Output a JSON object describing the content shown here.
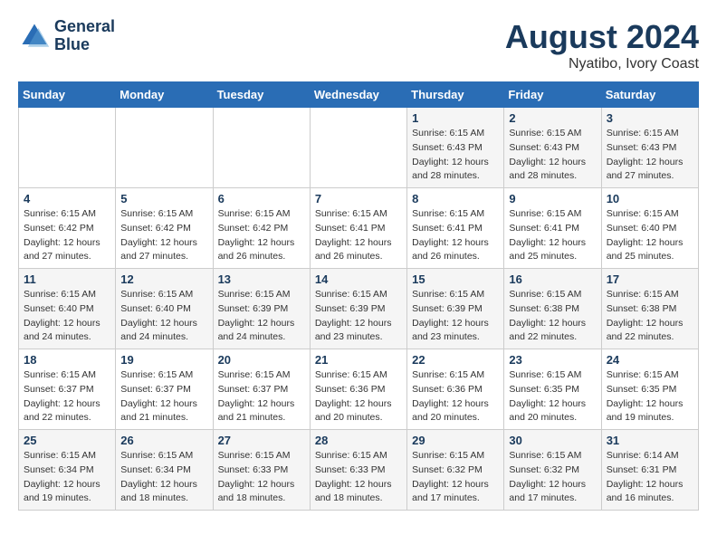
{
  "header": {
    "logo_line1": "General",
    "logo_line2": "Blue",
    "main_title": "August 2024",
    "subtitle": "Nyatibo, Ivory Coast"
  },
  "weekdays": [
    "Sunday",
    "Monday",
    "Tuesday",
    "Wednesday",
    "Thursday",
    "Friday",
    "Saturday"
  ],
  "weeks": [
    [
      {
        "day": "",
        "info": ""
      },
      {
        "day": "",
        "info": ""
      },
      {
        "day": "",
        "info": ""
      },
      {
        "day": "",
        "info": ""
      },
      {
        "day": "1",
        "info": "Sunrise: 6:15 AM\nSunset: 6:43 PM\nDaylight: 12 hours\nand 28 minutes."
      },
      {
        "day": "2",
        "info": "Sunrise: 6:15 AM\nSunset: 6:43 PM\nDaylight: 12 hours\nand 28 minutes."
      },
      {
        "day": "3",
        "info": "Sunrise: 6:15 AM\nSunset: 6:43 PM\nDaylight: 12 hours\nand 27 minutes."
      }
    ],
    [
      {
        "day": "4",
        "info": "Sunrise: 6:15 AM\nSunset: 6:42 PM\nDaylight: 12 hours\nand 27 minutes."
      },
      {
        "day": "5",
        "info": "Sunrise: 6:15 AM\nSunset: 6:42 PM\nDaylight: 12 hours\nand 27 minutes."
      },
      {
        "day": "6",
        "info": "Sunrise: 6:15 AM\nSunset: 6:42 PM\nDaylight: 12 hours\nand 26 minutes."
      },
      {
        "day": "7",
        "info": "Sunrise: 6:15 AM\nSunset: 6:41 PM\nDaylight: 12 hours\nand 26 minutes."
      },
      {
        "day": "8",
        "info": "Sunrise: 6:15 AM\nSunset: 6:41 PM\nDaylight: 12 hours\nand 26 minutes."
      },
      {
        "day": "9",
        "info": "Sunrise: 6:15 AM\nSunset: 6:41 PM\nDaylight: 12 hours\nand 25 minutes."
      },
      {
        "day": "10",
        "info": "Sunrise: 6:15 AM\nSunset: 6:40 PM\nDaylight: 12 hours\nand 25 minutes."
      }
    ],
    [
      {
        "day": "11",
        "info": "Sunrise: 6:15 AM\nSunset: 6:40 PM\nDaylight: 12 hours\nand 24 minutes."
      },
      {
        "day": "12",
        "info": "Sunrise: 6:15 AM\nSunset: 6:40 PM\nDaylight: 12 hours\nand 24 minutes."
      },
      {
        "day": "13",
        "info": "Sunrise: 6:15 AM\nSunset: 6:39 PM\nDaylight: 12 hours\nand 24 minutes."
      },
      {
        "day": "14",
        "info": "Sunrise: 6:15 AM\nSunset: 6:39 PM\nDaylight: 12 hours\nand 23 minutes."
      },
      {
        "day": "15",
        "info": "Sunrise: 6:15 AM\nSunset: 6:39 PM\nDaylight: 12 hours\nand 23 minutes."
      },
      {
        "day": "16",
        "info": "Sunrise: 6:15 AM\nSunset: 6:38 PM\nDaylight: 12 hours\nand 22 minutes."
      },
      {
        "day": "17",
        "info": "Sunrise: 6:15 AM\nSunset: 6:38 PM\nDaylight: 12 hours\nand 22 minutes."
      }
    ],
    [
      {
        "day": "18",
        "info": "Sunrise: 6:15 AM\nSunset: 6:37 PM\nDaylight: 12 hours\nand 22 minutes."
      },
      {
        "day": "19",
        "info": "Sunrise: 6:15 AM\nSunset: 6:37 PM\nDaylight: 12 hours\nand 21 minutes."
      },
      {
        "day": "20",
        "info": "Sunrise: 6:15 AM\nSunset: 6:37 PM\nDaylight: 12 hours\nand 21 minutes."
      },
      {
        "day": "21",
        "info": "Sunrise: 6:15 AM\nSunset: 6:36 PM\nDaylight: 12 hours\nand 20 minutes."
      },
      {
        "day": "22",
        "info": "Sunrise: 6:15 AM\nSunset: 6:36 PM\nDaylight: 12 hours\nand 20 minutes."
      },
      {
        "day": "23",
        "info": "Sunrise: 6:15 AM\nSunset: 6:35 PM\nDaylight: 12 hours\nand 20 minutes."
      },
      {
        "day": "24",
        "info": "Sunrise: 6:15 AM\nSunset: 6:35 PM\nDaylight: 12 hours\nand 19 minutes."
      }
    ],
    [
      {
        "day": "25",
        "info": "Sunrise: 6:15 AM\nSunset: 6:34 PM\nDaylight: 12 hours\nand 19 minutes."
      },
      {
        "day": "26",
        "info": "Sunrise: 6:15 AM\nSunset: 6:34 PM\nDaylight: 12 hours\nand 18 minutes."
      },
      {
        "day": "27",
        "info": "Sunrise: 6:15 AM\nSunset: 6:33 PM\nDaylight: 12 hours\nand 18 minutes."
      },
      {
        "day": "28",
        "info": "Sunrise: 6:15 AM\nSunset: 6:33 PM\nDaylight: 12 hours\nand 18 minutes."
      },
      {
        "day": "29",
        "info": "Sunrise: 6:15 AM\nSunset: 6:32 PM\nDaylight: 12 hours\nand 17 minutes."
      },
      {
        "day": "30",
        "info": "Sunrise: 6:15 AM\nSunset: 6:32 PM\nDaylight: 12 hours\nand 17 minutes."
      },
      {
        "day": "31",
        "info": "Sunrise: 6:14 AM\nSunset: 6:31 PM\nDaylight: 12 hours\nand 16 minutes."
      }
    ]
  ]
}
